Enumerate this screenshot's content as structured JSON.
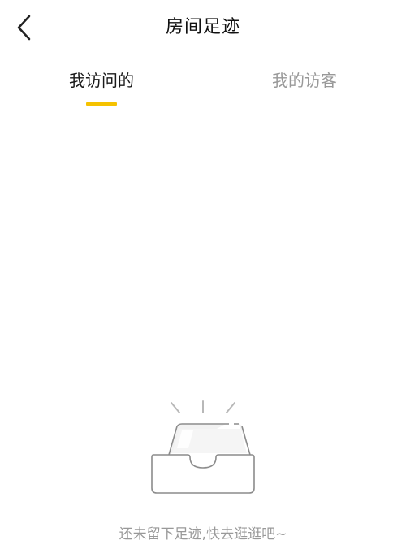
{
  "header": {
    "title": "房间足迹",
    "back_icon": "chevron-left-icon"
  },
  "tabs": [
    {
      "label": "我访问的",
      "active": true
    },
    {
      "label": "我的访客",
      "active": false
    }
  ],
  "colors": {
    "accent": "#f5c200",
    "active_tab_text": "#1a1a1a",
    "inactive_tab_text": "#999999",
    "empty_text": "#999999"
  },
  "empty_state": {
    "icon": "empty-box-icon",
    "message": "还未留下足迹,快去逛逛吧~"
  }
}
